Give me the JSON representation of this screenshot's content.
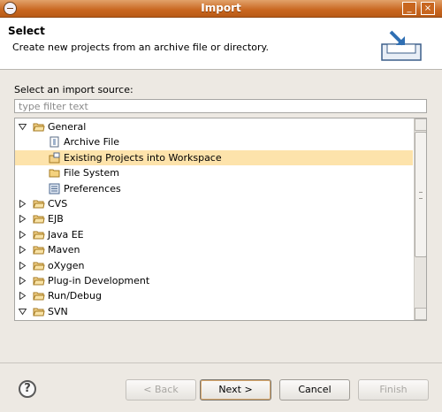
{
  "window": {
    "title": "Import"
  },
  "header": {
    "title": "Select",
    "description": "Create new projects from an archive file or directory."
  },
  "source": {
    "label": "Select an import source:",
    "filter_placeholder": "type filter text"
  },
  "tree": {
    "items": [
      {
        "label": "General",
        "expanded": true,
        "level": 0,
        "icon": "folder-open-icon"
      },
      {
        "label": "Archive File",
        "level": 1,
        "icon": "archive-icon"
      },
      {
        "label": "Existing Projects into Workspace",
        "level": 1,
        "icon": "project-icon",
        "selected": true
      },
      {
        "label": "File System",
        "level": 1,
        "icon": "folder-icon"
      },
      {
        "label": "Preferences",
        "level": 1,
        "icon": "preferences-icon"
      },
      {
        "label": "CVS",
        "expanded": false,
        "level": 0,
        "icon": "folder-open-icon"
      },
      {
        "label": "EJB",
        "expanded": false,
        "level": 0,
        "icon": "folder-open-icon"
      },
      {
        "label": "Java EE",
        "expanded": false,
        "level": 0,
        "icon": "folder-open-icon"
      },
      {
        "label": "Maven",
        "expanded": false,
        "level": 0,
        "icon": "folder-open-icon"
      },
      {
        "label": "oXygen",
        "expanded": false,
        "level": 0,
        "icon": "folder-open-icon"
      },
      {
        "label": "Plug-in Development",
        "expanded": false,
        "level": 0,
        "icon": "folder-open-icon"
      },
      {
        "label": "Run/Debug",
        "expanded": false,
        "level": 0,
        "icon": "folder-open-icon"
      },
      {
        "label": "SVN",
        "expanded": true,
        "level": 0,
        "icon": "folder-open-icon"
      }
    ]
  },
  "buttons": {
    "help": "?",
    "back": "< Back",
    "next": "Next >",
    "cancel": "Cancel",
    "finish": "Finish"
  },
  "colors": {
    "selection": "#fde3ab",
    "titlebar": "#c8661f"
  }
}
